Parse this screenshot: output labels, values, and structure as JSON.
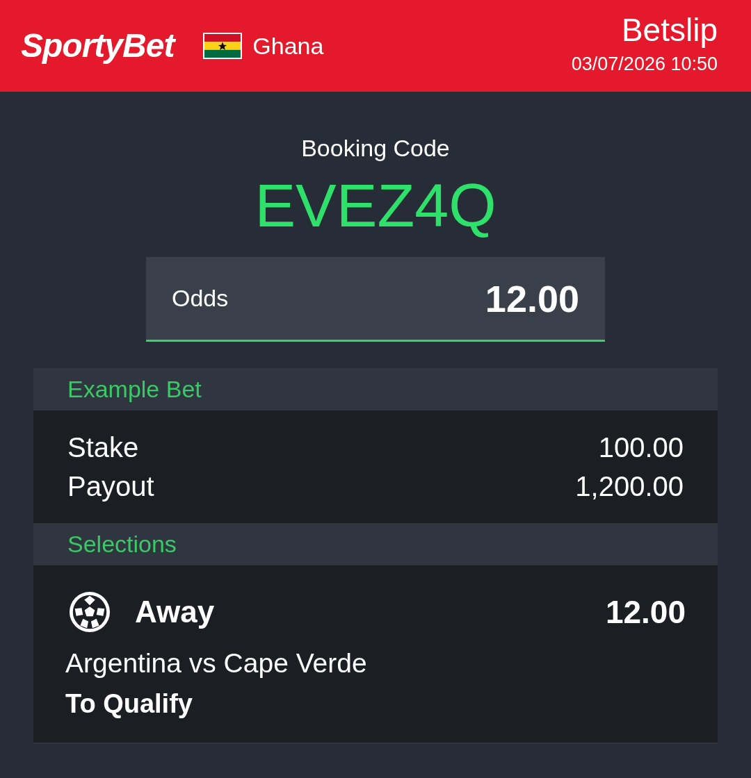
{
  "header": {
    "logo": "SportyBet",
    "country": "Ghana",
    "title": "Betslip",
    "datetime": "03/07/2026 10:50"
  },
  "booking": {
    "label": "Booking Code",
    "code": "EVEZ4Q"
  },
  "odds": {
    "label": "Odds",
    "value": "12.00"
  },
  "example_bet": {
    "title": "Example Bet",
    "rows": [
      {
        "label": "Stake",
        "value": "100.00"
      },
      {
        "label": "Payout",
        "value": "1,200.00"
      }
    ]
  },
  "selections": {
    "title": "Selections",
    "items": [
      {
        "pick": "Away",
        "odds": "12.00",
        "match": "Argentina vs Cape Verde",
        "market": "To Qualify"
      }
    ]
  }
}
